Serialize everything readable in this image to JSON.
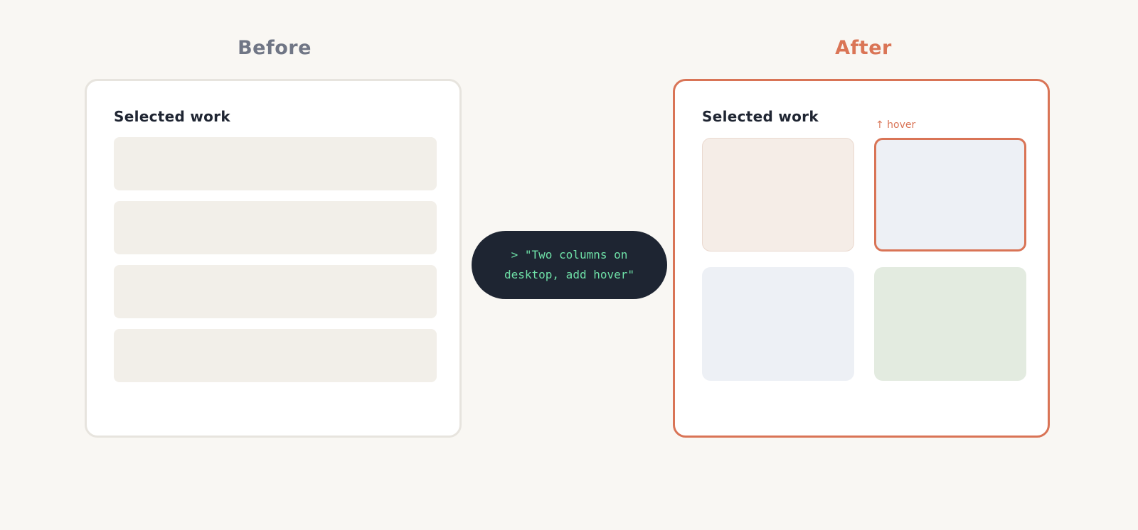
{
  "before": {
    "title": "Before",
    "heading": "Selected work",
    "row_count": 4
  },
  "after": {
    "title": "After",
    "heading": "Selected work",
    "hover_label": "↑ hover"
  },
  "prompt": {
    "text": "> \"Two columns on desktop, add hover\""
  },
  "colors": {
    "accent": "#d97456",
    "muted_title": "#707685",
    "heading": "#1f2532",
    "placeholder_row": "#f2efe9",
    "card_peach": "#f5ede7",
    "card_blue": "#edf0f5",
    "card_green": "#e3ebe0",
    "pill_bg": "#1e2532",
    "pill_text": "#6ee0a7"
  }
}
